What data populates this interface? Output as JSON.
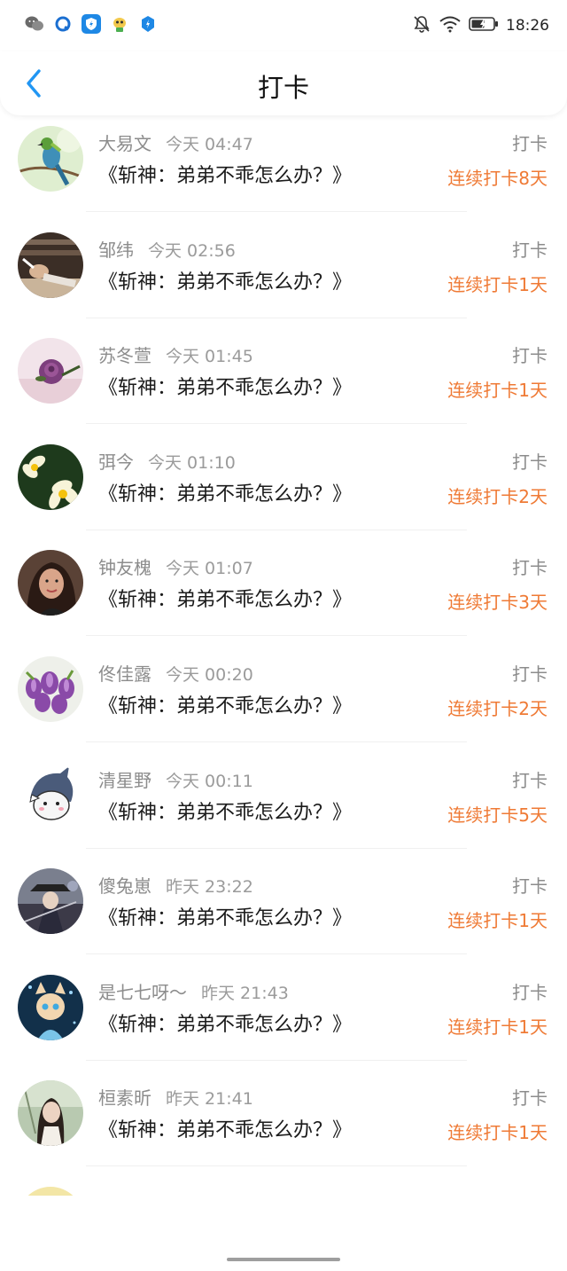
{
  "status_bar": {
    "time": "18:26",
    "left_icons": [
      "wechat-icon",
      "qq-browser-icon",
      "shield-app-icon",
      "mascot-app-icon",
      "security-badge-icon"
    ],
    "right_icons": [
      "mute-bell-icon",
      "wifi-icon",
      "battery-icon"
    ]
  },
  "header": {
    "title": "打卡",
    "back_icon": "chevron-left-icon",
    "accent_color": "#2196F3"
  },
  "colors": {
    "streak": "#EF7A35",
    "muted_text": "#8C8C8C"
  },
  "records": [
    {
      "user": "大易文",
      "time": "今天 04:47",
      "book": "《斩神：弟弟不乖怎么办？》",
      "action": "打卡",
      "streak": "连续打卡8天",
      "avatar": "bird-avatar"
    },
    {
      "user": "邹纬",
      "time": "今天 02:56",
      "book": "《斩神：弟弟不乖怎么办？》",
      "action": "打卡",
      "streak": "连续打卡1天",
      "avatar": "sleeping-man-avatar"
    },
    {
      "user": "苏冬萱",
      "time": "今天 01:45",
      "book": "《斩神：弟弟不乖怎么办？》",
      "action": "打卡",
      "streak": "连续打卡1天",
      "avatar": "rose-avatar"
    },
    {
      "user": "弭今",
      "time": "今天 01:10",
      "book": "《斩神：弟弟不乖怎么办？》",
      "action": "打卡",
      "streak": "连续打卡2天",
      "avatar": "frangipani-avatar"
    },
    {
      "user": "钟友槐",
      "time": "今天 01:07",
      "book": "《斩神：弟弟不乖怎么办？》",
      "action": "打卡",
      "streak": "连续打卡3天",
      "avatar": "woman-selfie-avatar"
    },
    {
      "user": "佟佳露",
      "time": "今天 00:20",
      "book": "《斩神：弟弟不乖怎么办？》",
      "action": "打卡",
      "streak": "连续打卡2天",
      "avatar": "tulips-avatar"
    },
    {
      "user": "清星野",
      "time": "今天 00:11",
      "book": "《斩神：弟弟不乖怎么办？》",
      "action": "打卡",
      "streak": "连续打卡5天",
      "avatar": "shark-cartoon-avatar"
    },
    {
      "user": "傻兔崽",
      "time": "昨天 23:22",
      "book": "《斩神：弟弟不乖怎么办？》",
      "action": "打卡",
      "streak": "连续打卡1天",
      "avatar": "anime-swordsman-avatar"
    },
    {
      "user": "是七七呀～",
      "time": "昨天 21:43",
      "book": "《斩神：弟弟不乖怎么办？》",
      "action": "打卡",
      "streak": "连续打卡1天",
      "avatar": "anime-cat-girl-avatar"
    },
    {
      "user": "桓素昕",
      "time": "昨天 21:41",
      "book": "《斩神：弟弟不乖怎么办？》",
      "action": "打卡",
      "streak": "连续打卡1天",
      "avatar": "girl-photo-avatar"
    }
  ]
}
